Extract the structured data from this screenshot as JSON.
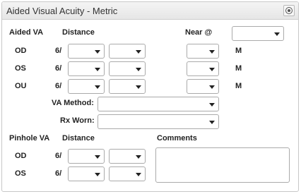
{
  "panel": {
    "title": "Aided Visual Acuity - Metric"
  },
  "aided": {
    "section_label": "Aided VA",
    "distance_label": "Distance",
    "near_label": "Near @",
    "near_value": "",
    "unit": "M",
    "prefix": "6/",
    "rows": [
      {
        "eye": "OD",
        "dist_a": "",
        "dist_b": "",
        "near": ""
      },
      {
        "eye": "OS",
        "dist_a": "",
        "dist_b": "",
        "near": ""
      },
      {
        "eye": "OU",
        "dist_a": "",
        "dist_b": "",
        "near": ""
      }
    ],
    "va_method_label": "VA Method:",
    "va_method_value": "",
    "rx_worn_label": "Rx Worn:",
    "rx_worn_value": ""
  },
  "pinhole": {
    "section_label": "Pinhole VA",
    "distance_label": "Distance",
    "comments_label": "Comments",
    "comments_value": "",
    "prefix": "6/",
    "rows": [
      {
        "eye": "OD",
        "dist_a": "",
        "dist_b": ""
      },
      {
        "eye": "OS",
        "dist_a": "",
        "dist_b": ""
      }
    ]
  }
}
